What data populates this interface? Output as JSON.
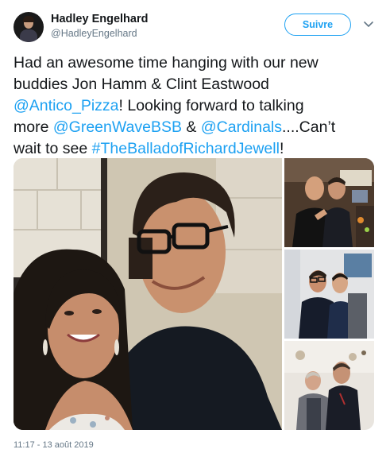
{
  "user": {
    "name": "Hadley Engelhard",
    "handle": "@HadleyEngelhard"
  },
  "follow_button": {
    "label": "Suivre"
  },
  "tweet": {
    "line1": "Had an awesome time hanging with our new",
    "line2": "buddies Jon Hamm & Clint Eastwood",
    "mention_antico": "@Antico_Pizza",
    "line3_rest": "! Looking forward to talking",
    "line4_pre": "more ",
    "mention_greenwave": "@GreenWaveBSB",
    "line4_amp": " & ",
    "mention_cardinals": "@Cardinals",
    "line4_rest": "....Can’t",
    "line5_pre": "wait to see ",
    "hashtag": "#TheBalladofRichardJewell",
    "line5_end": "!"
  },
  "timestamp": "11:17 - 13 août 2019",
  "colors": {
    "link": "#1da1f2",
    "text": "#14171a",
    "secondary": "#657786"
  },
  "icons": {
    "more": "chevron-down-icon"
  }
}
